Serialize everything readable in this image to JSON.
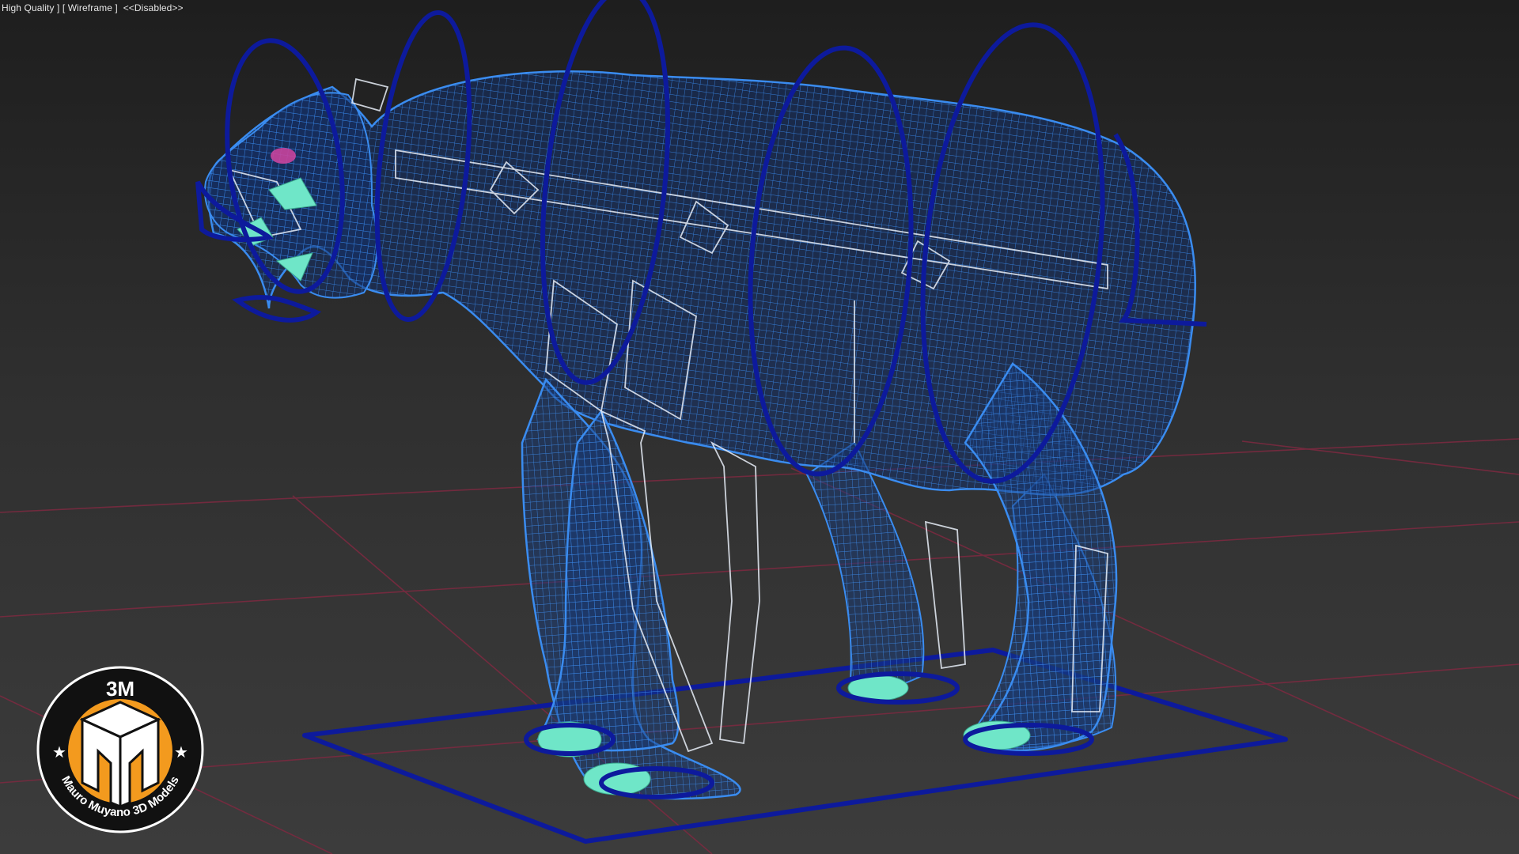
{
  "viewport": {
    "menu_label": "High Quality ] [ Wireframe ]  <<Disabled>>",
    "render_mode": "Wireframe",
    "shading_quality": "High Quality"
  },
  "scene": {
    "object": "bear-rig-wireframe",
    "colors": {
      "background": "#2a2a2a",
      "mesh": "#2f7fe8",
      "bones": "#e8eef8",
      "controls": "#0d1a9c",
      "grid": "#7a2a40",
      "teeth_claws": "#6fe6c8",
      "tongue": "#c8449c"
    }
  },
  "watermark": {
    "top_text": "3M",
    "ring_text": "Mauro Muyano 3D Models",
    "ring_color": "#ffffff",
    "badge_color": "#111111",
    "accent_color": "#f39a1e"
  }
}
